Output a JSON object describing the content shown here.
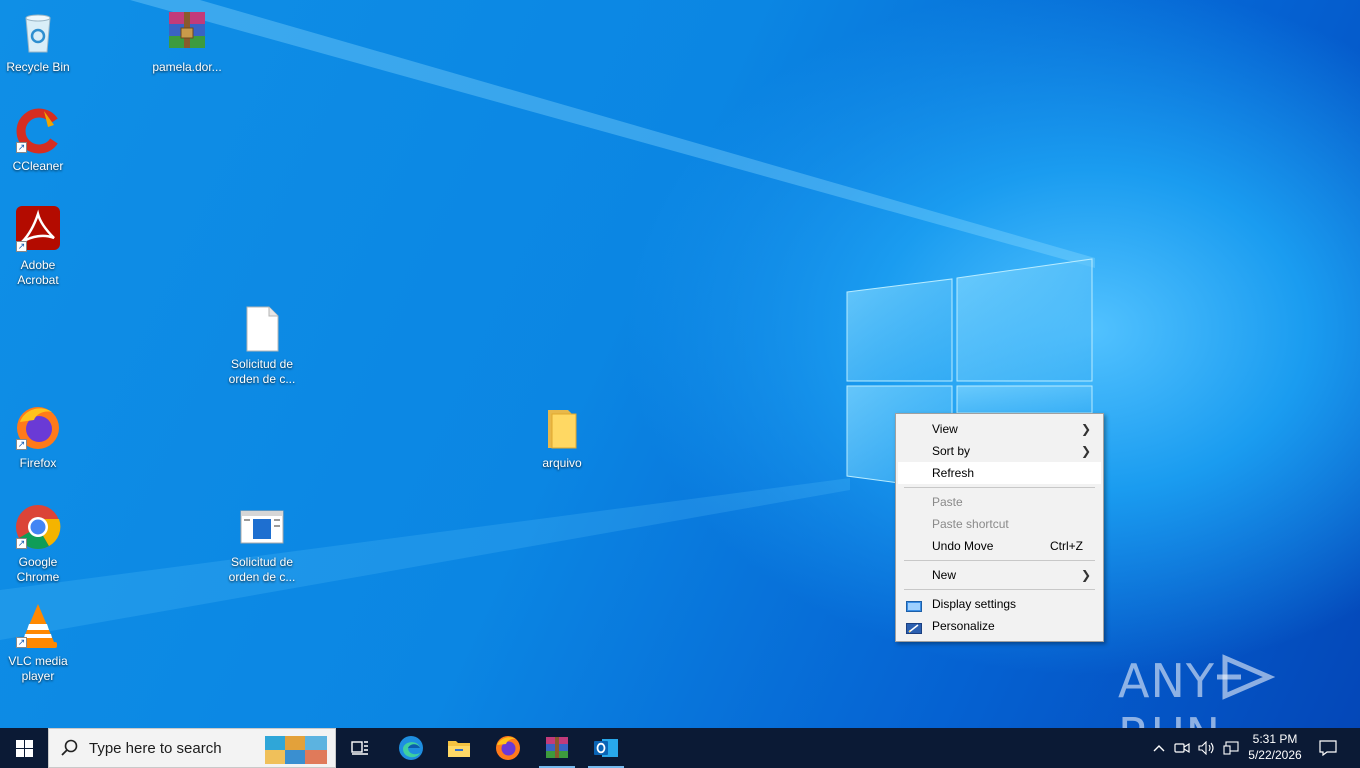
{
  "desktop": {
    "icons": [
      {
        "label": "Recycle Bin",
        "icon": "recycle-bin-icon"
      },
      {
        "label": "pamela.dor...",
        "icon": "winrar-archive-icon"
      },
      {
        "label": "CCleaner",
        "icon": "ccleaner-icon"
      },
      {
        "label": "Adobe Acrobat",
        "icon": "adobe-acrobat-icon"
      },
      {
        "label": "Solicitud de orden de c...",
        "icon": "blank-document-icon"
      },
      {
        "label": "Firefox",
        "icon": "firefox-icon"
      },
      {
        "label": "arquivo",
        "icon": "folder-icon"
      },
      {
        "label": "Google Chrome",
        "icon": "chrome-icon"
      },
      {
        "label": "Solicitud de orden de c...",
        "icon": "window-document-icon"
      },
      {
        "label": "VLC media player",
        "icon": "vlc-icon"
      }
    ]
  },
  "context_menu": {
    "items": [
      {
        "label": "View",
        "submenu": true
      },
      {
        "label": "Sort by",
        "submenu": true
      },
      {
        "label": "Refresh",
        "highlighted": true
      },
      {
        "label": "Paste",
        "disabled": true
      },
      {
        "label": "Paste shortcut",
        "disabled": true
      },
      {
        "label": "Undo Move",
        "shortcut": "Ctrl+Z"
      },
      {
        "label": "New",
        "submenu": true
      },
      {
        "label": "Display settings",
        "icon": "display-settings-icon"
      },
      {
        "label": "Personalize",
        "icon": "personalize-icon"
      }
    ]
  },
  "watermark": {
    "left": "ANY",
    "right": "RUN"
  },
  "taskbar": {
    "search_placeholder": "Type here to search",
    "pinned": [
      "task-view-icon",
      "edge-icon",
      "file-explorer-icon",
      "firefox-icon",
      "winrar-icon",
      "outlook-icon"
    ],
    "clock": {
      "time": "5:31 PM",
      "date": "5/22/2026"
    }
  },
  "colors": {
    "accent": "#0078d7",
    "taskbar": "#0b1a35",
    "menu_bg": "#f2f2f2"
  }
}
